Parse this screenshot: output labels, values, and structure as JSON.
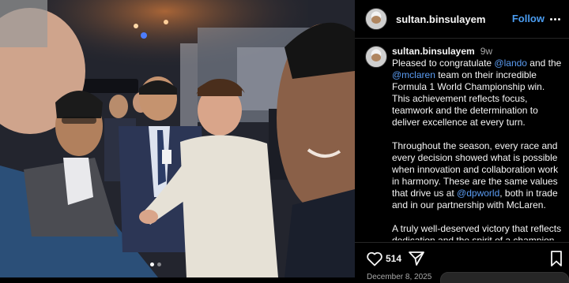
{
  "post": {
    "username": "sultan.binsulayem",
    "follow_label": "Follow",
    "time_ago": "9w",
    "caption": {
      "p1_a": "Pleased to congratulate ",
      "mention_1": "@lando",
      "p1_b": " and the ",
      "mention_2": "@mclaren",
      "p1_c": " team on their incredible Formula 1 World Championship win. This achievement reflects focus, teamwork and the determination to deliver excellence at every turn.",
      "p2_a": "Throughout the season, every race and every decision showed what is possible when innovation and collaboration work in harmony. These are the same values that drive us at ",
      "mention_3": "@dpworld",
      "p2_b": ", both in trade and in our partnership with McLaren.",
      "p3": "A truly well-deserved victory that reflects dedication and the spirit of a champion."
    },
    "likes": "514",
    "date": "December 8, 2025",
    "carousel": {
      "count": 2,
      "active_index": 0
    }
  },
  "icons": [
    "heart-icon",
    "share-icon",
    "bookmark-icon",
    "more-icon"
  ],
  "colors": {
    "background": "#000000",
    "link": "#4a9cf0",
    "muted": "#a8a8a8",
    "text": "#f5f5f5"
  }
}
